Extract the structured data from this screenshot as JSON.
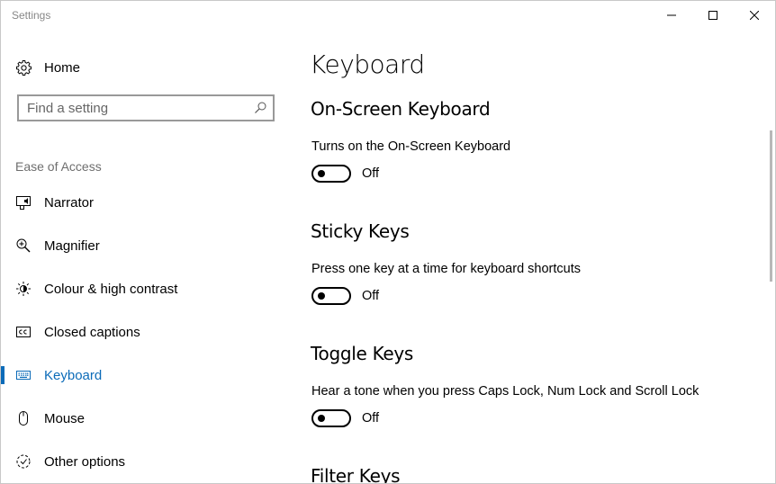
{
  "window": {
    "title": "Settings"
  },
  "sidebar": {
    "home_label": "Home",
    "search": {
      "placeholder": "Find a setting"
    },
    "group_heading": "Ease of Access",
    "items": [
      {
        "label": "Narrator",
        "icon": "narrator-icon"
      },
      {
        "label": "Magnifier",
        "icon": "magnifier-icon"
      },
      {
        "label": "Colour & high contrast",
        "icon": "brightness-icon"
      },
      {
        "label": "Closed captions",
        "icon": "closed-captions-icon"
      },
      {
        "label": "Keyboard",
        "icon": "keyboard-icon",
        "selected": true
      },
      {
        "label": "Mouse",
        "icon": "mouse-icon"
      },
      {
        "label": "Other options",
        "icon": "other-options-icon"
      }
    ]
  },
  "main": {
    "page_title": "Keyboard",
    "sections": [
      {
        "title": "On-Screen Keyboard",
        "description": "Turns on the On-Screen Keyboard",
        "state": "Off"
      },
      {
        "title": "Sticky Keys",
        "description": "Press one key at a time for keyboard shortcuts",
        "state": "Off"
      },
      {
        "title": "Toggle Keys",
        "description": "Hear a tone when you press Caps Lock, Num Lock and Scroll Lock",
        "state": "Off"
      },
      {
        "title": "Filter Keys"
      }
    ]
  },
  "colors": {
    "accent": "#0b6bb8",
    "group_heading": "#6e6e6e"
  }
}
